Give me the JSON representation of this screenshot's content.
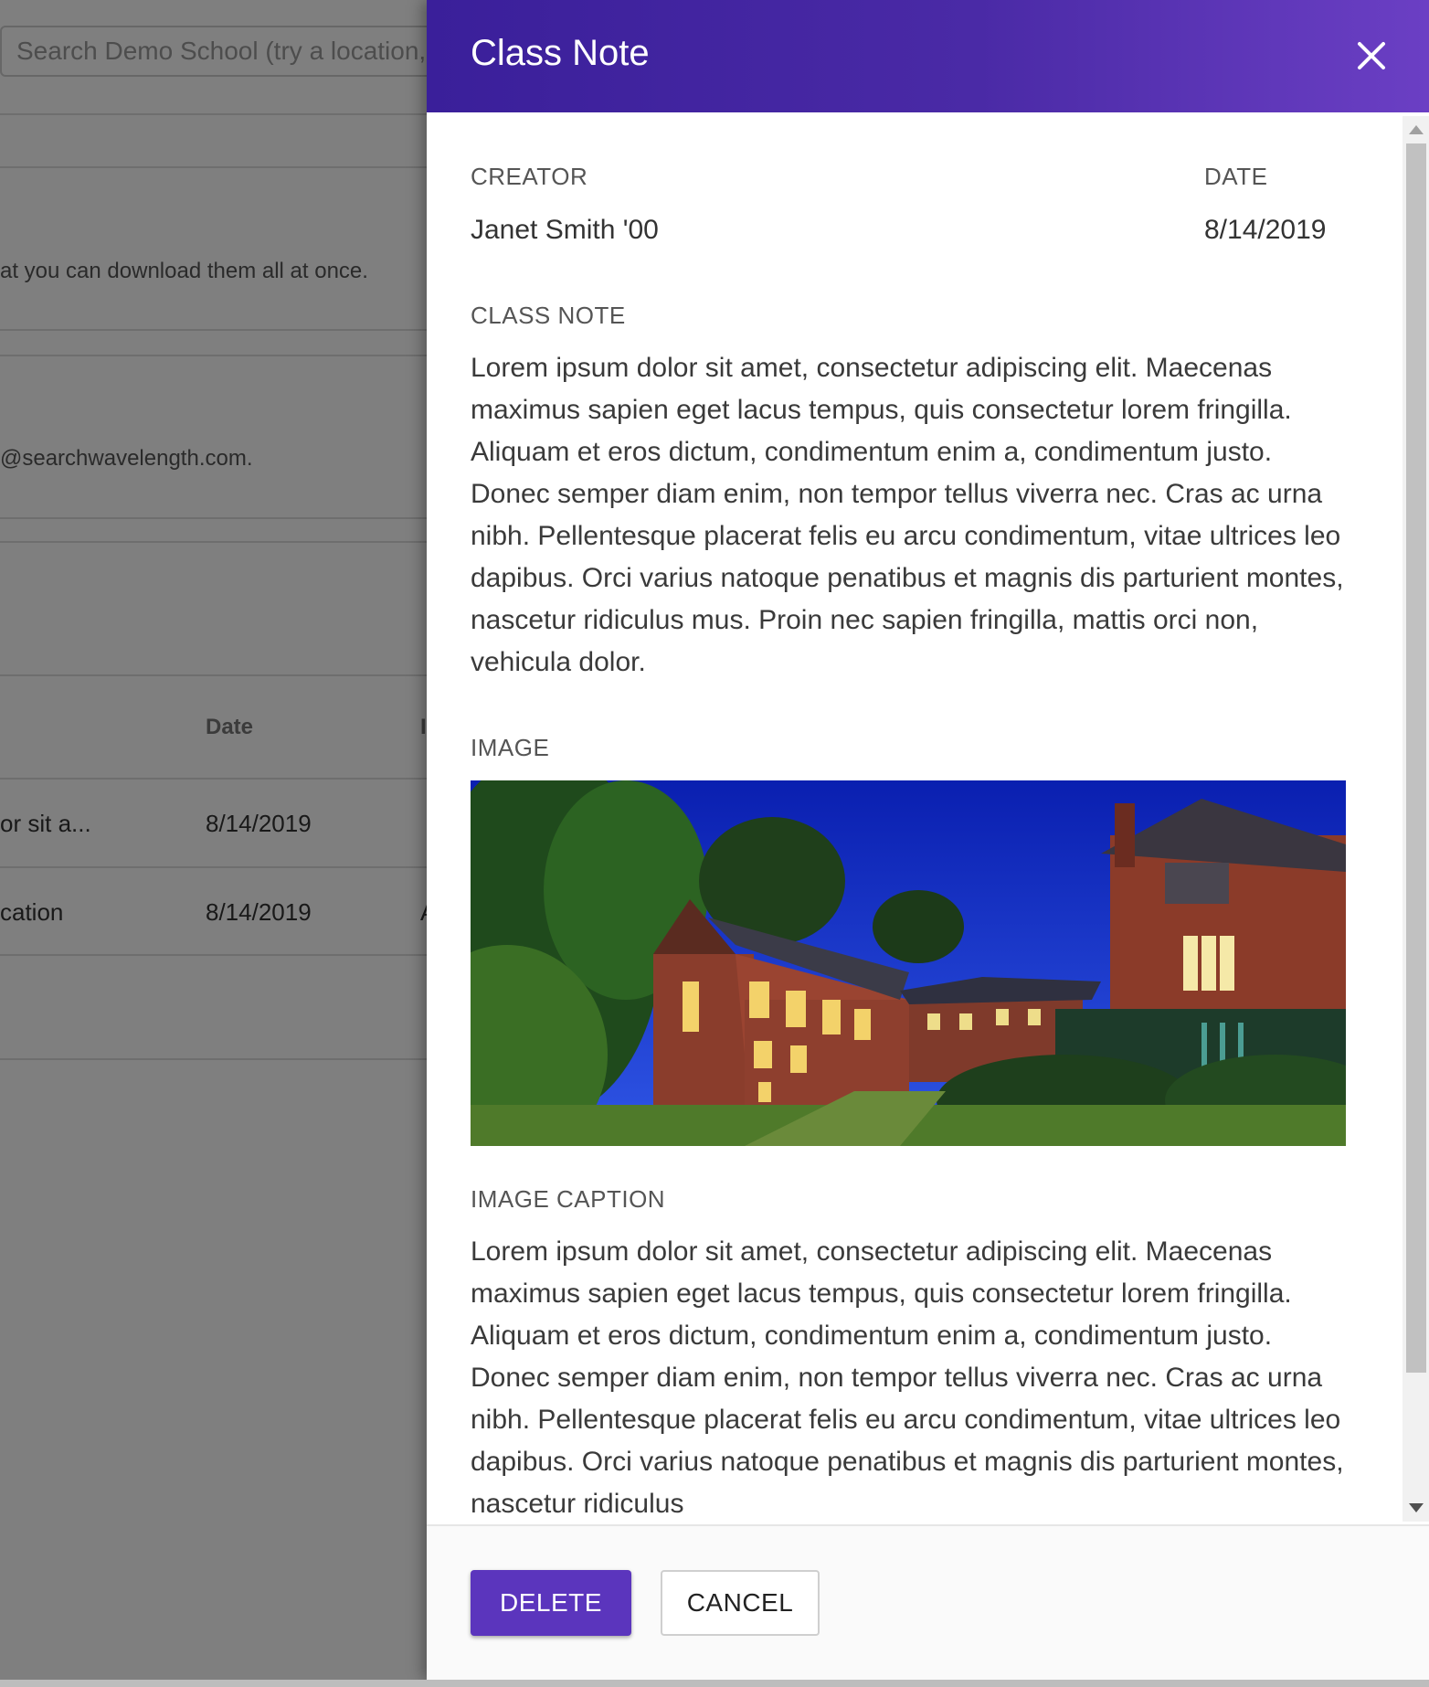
{
  "background": {
    "search_placeholder": "Search Demo School (try a location, y",
    "text_download": "at you can download them all at once.",
    "text_email": "@searchwavelength.com.",
    "table": {
      "header_date": "Date",
      "header_next": "I",
      "rows": [
        {
          "title": "or sit a...",
          "date": "8/14/2019",
          "extra": ""
        },
        {
          "title": "cation",
          "date": "8/14/2019",
          "extra": "A"
        }
      ]
    }
  },
  "modal": {
    "title": "Class Note",
    "close_icon": "close-icon",
    "creator_label": "CREATOR",
    "creator_value": "Janet Smith '00",
    "date_label": "DATE",
    "date_value": "8/14/2019",
    "class_note_label": "CLASS NOTE",
    "class_note_text": "Lorem ipsum dolor sit amet, consectetur adipiscing elit. Maecenas maximus sapien eget lacus tempus, quis consectetur lorem fringilla. Aliquam et eros dictum, condimentum enim a, condimentum justo. Donec semper diam enim, non tempor tellus viverra nec. Cras ac urna nibh. Pellentesque placerat felis eu arcu condimentum, vitae ultrices leo dapibus. Orci varius natoque penatibus et magnis dis parturient montes, nascetur ridiculus mus. Proin nec sapien fringilla, mattis orci non, vehicula dolor.",
    "image_label": "IMAGE",
    "image_caption_label": "IMAGE CAPTION",
    "image_caption_text": "Lorem ipsum dolor sit amet, consectetur adipiscing elit. Maecenas maximus sapien eget lacus tempus, quis consectetur lorem fringilla. Aliquam et eros dictum, condimentum enim a, condimentum justo. Donec semper diam enim, non tempor tellus viverra nec. Cras ac urna nibh. Pellentesque placerat felis eu arcu condimentum, vitae ultrices leo dapibus. Orci varius natoque penatibus et magnis dis parturient montes, nascetur ridiculus",
    "delete_label": "DELETE",
    "cancel_label": "CANCEL"
  },
  "colors": {
    "header_start": "#3a1f9a",
    "header_end": "#6b3fc4",
    "primary_button": "#5b35bd",
    "overlay": "rgba(0,0,0,0.5)"
  }
}
